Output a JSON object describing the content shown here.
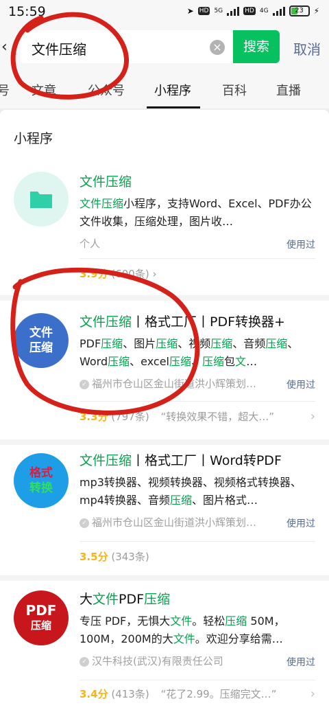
{
  "status_bar": {
    "time": "15:59",
    "network": "5G",
    "network2": "4G",
    "battery": "23"
  },
  "search": {
    "query": "文件压缩",
    "button": "搜索",
    "cancel": "取消"
  },
  "tabs": [
    {
      "label": "号"
    },
    {
      "label": "文章"
    },
    {
      "label": "公众号"
    },
    {
      "label": "小程序"
    },
    {
      "label": "百科"
    },
    {
      "label": "直播"
    }
  ],
  "section_title": "小程序",
  "results": [
    {
      "name": "文件压缩",
      "logo_text": "",
      "desc_hl": "文件压缩",
      "desc": "小程序，支持Word、Excel、PDF办公文件收集，压缩处理，图片收…",
      "meta": "个人",
      "used": "使用过",
      "score": "3.9分",
      "count": "(600条)",
      "quote": ""
    },
    {
      "name_hl": "文件压缩",
      "name_rest": "丨格式工厂丨PDF转换器+",
      "logo_line1": "文件",
      "logo_line2": "压缩",
      "desc_line1_a": "PDF",
      "desc_line1_b": "压缩",
      "desc_line1_c": "、图片",
      "desc_line1_d": "压缩",
      "desc_line1_e": "、视频",
      "desc_line1_f": "压缩",
      "desc_line1_g": "、音频",
      "desc_line1_h": "压",
      "desc_line2_a": "缩",
      "desc_line2_b": "、Word",
      "desc_line2_c": "压缩",
      "desc_line2_d": "、excel",
      "desc_line2_e": "压缩",
      "desc_line2_f": "、",
      "desc_line2_g": "压缩",
      "desc_line2_h": "包",
      "desc_line2_i": "文",
      "desc_line2_j": "…",
      "meta": "福州市仓山区金山街道洪小辉策划…",
      "used": "使用过",
      "score": "3.3分",
      "count": "(797条)",
      "quote": "“转换效果不错，超大…”"
    },
    {
      "name_hl": "文件压缩",
      "name_rest": "丨格式工厂丨Word转PDF",
      "logo_line1": "格式",
      "logo_line2": "转换",
      "desc_a": "mp3转换器、视频转换器、视频格式转换器、mp4转换器、音频",
      "desc_b": "压缩",
      "desc_c": "、图片格式…",
      "meta": "福州市仓山区金山街道洪小辉策划…",
      "used": "使用过",
      "score": "3.5分",
      "count": "(343条)",
      "quote": ""
    },
    {
      "name_a": "大",
      "name_b": "文件",
      "name_c": "PDF",
      "name_d": "压缩",
      "logo_line1": "PDF",
      "logo_line2": "压缩",
      "desc_a": "专压 PDF，无惧大",
      "desc_b": "文件",
      "desc_c": "。轻松",
      "desc_d": "压缩",
      "desc_e": " 50M，100M，200M的大",
      "desc_f": "文件",
      "desc_g": "。欢迎分享给需…",
      "meta": "汉牛科技(武汉)有限责任公司",
      "used": "使用过",
      "score": "3.4分",
      "count": "(413条)",
      "quote": "“花了2.99。压缩完文…”"
    }
  ]
}
